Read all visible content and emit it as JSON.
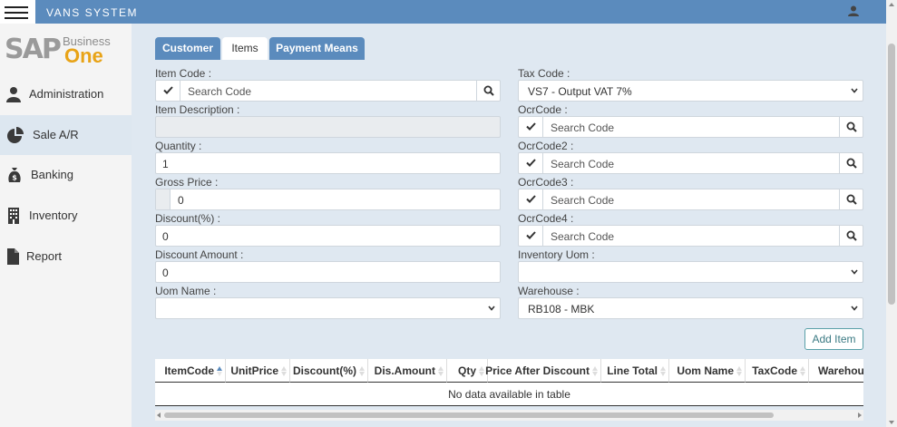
{
  "app": {
    "title": "VANS SYSTEM"
  },
  "logo": {
    "sap": "SAP",
    "business": "Business",
    "one": "One"
  },
  "sidebar": {
    "items": [
      {
        "label": "Administration",
        "icon": "user-icon"
      },
      {
        "label": "Sale A/R",
        "icon": "pie-chart-icon",
        "active": true
      },
      {
        "label": "Banking",
        "icon": "money-bag-icon"
      },
      {
        "label": "Inventory",
        "icon": "building-icon"
      },
      {
        "label": "Report",
        "icon": "document-icon"
      }
    ]
  },
  "tabs": [
    {
      "label": "Customer",
      "active": false
    },
    {
      "label": "Items",
      "active": true
    },
    {
      "label": "Payment Means",
      "active": false
    }
  ],
  "form": {
    "item_code": {
      "label": "Item Code :",
      "placeholder": "Search Code"
    },
    "item_description": {
      "label": "Item Description :",
      "value": ""
    },
    "quantity": {
      "label": "Quantity :",
      "value": "1"
    },
    "gross_price": {
      "label": "Gross Price :",
      "value": "0"
    },
    "discount_pct": {
      "label": "Discount(%) :",
      "value": "0"
    },
    "discount_amount": {
      "label": "Discount Amount :",
      "value": "0"
    },
    "uom_name": {
      "label": "Uom Name :",
      "value": ""
    },
    "tax_code": {
      "label": "Tax Code :",
      "value": "VS7 - Output VAT 7%"
    },
    "ocr_code": {
      "label": "OcrCode :",
      "placeholder": "Search Code"
    },
    "ocr_code2": {
      "label": "OcrCode2 :",
      "placeholder": "Search Code"
    },
    "ocr_code3": {
      "label": "OcrCode3 :",
      "placeholder": "Search Code"
    },
    "ocr_code4": {
      "label": "OcrCode4 :",
      "placeholder": "Search Code"
    },
    "inventory_uom": {
      "label": "Inventory Uom :",
      "value": ""
    },
    "warehouse": {
      "label": "Warehouse :",
      "value": "RB108 - MBK"
    }
  },
  "actions": {
    "add_item": "Add Item"
  },
  "table": {
    "columns": [
      "ItemCode",
      "UnitPrice",
      "Discount(%)",
      "Dis.Amount",
      "Qty",
      "Price After Discount",
      "Line Total",
      "Uom Name",
      "TaxCode",
      "Warehouse"
    ],
    "empty_message": "No data available in table"
  },
  "colors": {
    "primary": "#5b8bbd",
    "background": "#dfe8f1",
    "accent": "#e8a317"
  }
}
